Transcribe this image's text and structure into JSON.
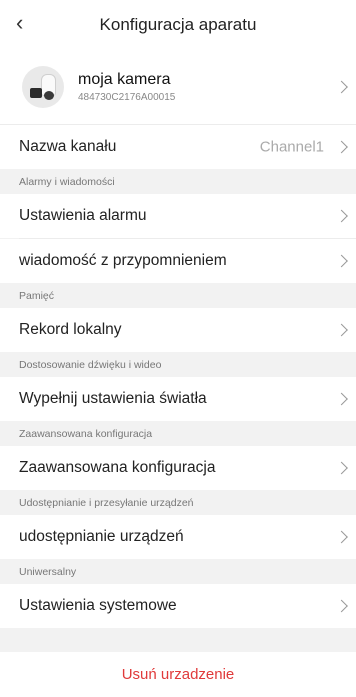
{
  "header": {
    "title": "Konfiguracja aparatu"
  },
  "device": {
    "name": "moja kamera",
    "serial": "484730C2176A00015"
  },
  "channel": {
    "label": "Nazwa kanału",
    "value": "Channel1"
  },
  "sections": {
    "alarms": "Alarmy i wiadomości",
    "memory": "Pamięć",
    "av": "Dostosowanie dźwięku i wideo",
    "advanced": "Zaawansowana konfiguracja",
    "sharing": "Udostępnianie i przesyłanie urządzeń",
    "universal": "Uniwersalny"
  },
  "items": {
    "alarm_settings": "Ustawienia alarmu",
    "reminder_message": "wiadomość z przypomnieniem",
    "local_record": "Rekord lokalny",
    "light_settings": "Wypełnij ustawienia światła",
    "advanced_config": "Zaawansowana konfiguracja",
    "device_sharing": "udostępnianie urządzeń",
    "system_settings": "Ustawienia systemowe"
  },
  "delete_label": "Usuń urzadzenie",
  "icons": {
    "back": "back-arrow-icon",
    "chevron": "chevron-right-icon",
    "camera": "camera-thumbnail"
  },
  "colors": {
    "danger": "#e03a3a"
  }
}
